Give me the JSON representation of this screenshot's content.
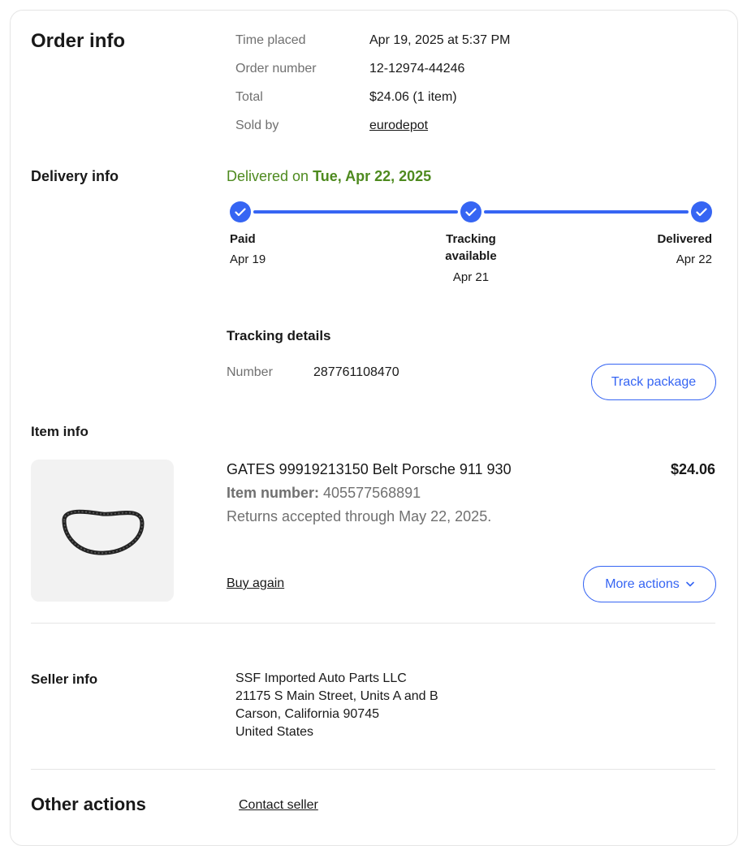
{
  "order_info": {
    "heading": "Order info",
    "rows": [
      {
        "label": "Time placed",
        "value": "Apr 19, 2025 at 5:37 PM"
      },
      {
        "label": "Order number",
        "value": "12-12974-44246"
      },
      {
        "label": "Total",
        "value": "$24.06 (1 item)"
      },
      {
        "label": "Sold by",
        "value": "eurodepot"
      }
    ]
  },
  "delivery_info": {
    "heading": "Delivery info",
    "status_prefix": "Delivered on",
    "status_date": "Tue, Apr 22, 2025",
    "status_color": "#4e8a1f",
    "accent_color": "#3665f3",
    "steps": [
      {
        "label": "Paid",
        "date": "Apr 19"
      },
      {
        "label_line1": "Tracking",
        "label_line2": "available",
        "date": "Apr 21"
      },
      {
        "label": "Delivered",
        "date": "Apr 22"
      }
    ],
    "tracking": {
      "heading": "Tracking details",
      "number_label": "Number",
      "number_value": "287761108470",
      "button_label": "Track package"
    }
  },
  "item_info": {
    "heading": "Item info",
    "title": "GATES 99919213150 Belt Porsche 911 930",
    "price": "$24.06",
    "item_number_label": "Item number:",
    "item_number_value": "405577568891",
    "returns": "Returns accepted through May 22, 2025.",
    "buy_again": "Buy again",
    "more_actions": "More actions",
    "image_icon": "timing-belt-image"
  },
  "seller_info": {
    "heading": "Seller info",
    "address_lines": [
      "SSF Imported Auto Parts LLC",
      "21175 S Main Street, Units A and B",
      "Carson, California 90745",
      "United States"
    ]
  },
  "other_actions": {
    "heading": "Other actions",
    "contact_seller": "Contact seller"
  }
}
